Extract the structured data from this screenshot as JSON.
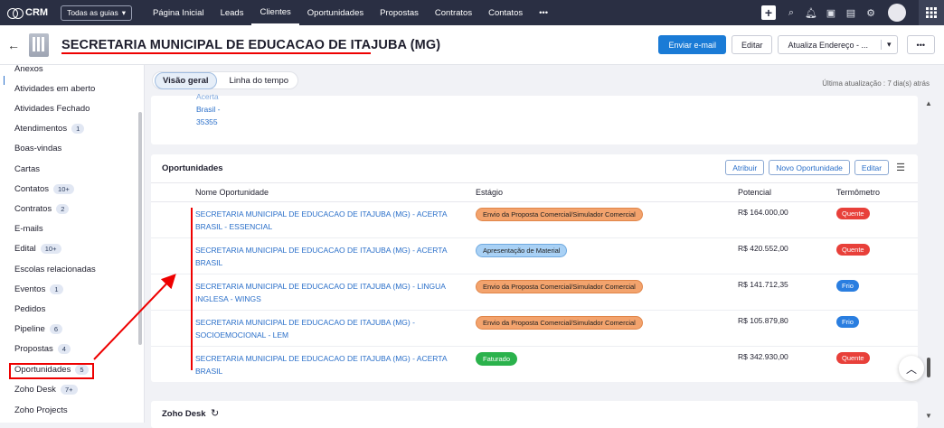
{
  "topbar": {
    "app": "CRM",
    "guides": "Todas as guias",
    "nav": [
      "Página Inicial",
      "Leads",
      "Clientes",
      "Oportunidades",
      "Propostas",
      "Contratos",
      "Contatos",
      "•••"
    ]
  },
  "header": {
    "title": "SECRETARIA MUNICIPAL DE EDUCACAO DE ITAJUBA (MG)",
    "send_email": "Enviar e-mail",
    "edit": "Editar",
    "update": "Atualiza Endereço - ...",
    "more": "•••"
  },
  "sidebar": [
    {
      "label": "Anexos",
      "badge": ""
    },
    {
      "label": "Atividades em aberto",
      "badge": ""
    },
    {
      "label": "Atividades Fechado",
      "badge": ""
    },
    {
      "label": "Atendimentos",
      "badge": "1"
    },
    {
      "label": "Boas-vindas",
      "badge": ""
    },
    {
      "label": "Cartas",
      "badge": ""
    },
    {
      "label": "Contatos",
      "badge": "10+"
    },
    {
      "label": "Contratos",
      "badge": "2"
    },
    {
      "label": "E-mails",
      "badge": ""
    },
    {
      "label": "Edital",
      "badge": "10+"
    },
    {
      "label": "Escolas relacionadas",
      "badge": ""
    },
    {
      "label": "Eventos",
      "badge": "1"
    },
    {
      "label": "Pedidos",
      "badge": ""
    },
    {
      "label": "Pipeline",
      "badge": "6"
    },
    {
      "label": "Propostas",
      "badge": "4"
    },
    {
      "label": "Oportunidades",
      "badge": "5"
    },
    {
      "label": "Zoho Desk",
      "badge": "7+"
    },
    {
      "label": "Zoho Projects",
      "badge": ""
    }
  ],
  "tabs": {
    "overview": "Visão geral",
    "timeline": "Linha do tempo"
  },
  "last_update": "Última atualização : 7 dia(s) atrás",
  "address": [
    "Acerta",
    "Brasil -",
    "35355"
  ],
  "opps": {
    "title": "Oportunidades",
    "assign": "Atribuir",
    "new": "Novo Oportunidade",
    "edit": "Editar",
    "columns": [
      "Nome Oportunidade",
      "Estágio",
      "Potencial",
      "Termômetro"
    ],
    "rows": [
      {
        "name": "SECRETARIA MUNICIPAL DE EDUCACAO DE ITAJUBA (MG) - ACERTA BRASIL - ESSENCIAL",
        "stage": "Envio da Proposta Comercial/Simulador Comercial",
        "value": "R$ 164.000,00",
        "therm": "Quente"
      },
      {
        "name": "SECRETARIA MUNICIPAL DE EDUCACAO DE ITAJUBA (MG) - ACERTA BRASIL",
        "stage": "Apresentação de Material",
        "value": "R$ 420.552,00",
        "therm": "Quente"
      },
      {
        "name": "SECRETARIA MUNICIPAL DE EDUCACAO DE ITAJUBA (MG) - LINGUA INGLESA - WINGS",
        "stage": "Envio da Proposta Comercial/Simulador Comercial",
        "value": "R$ 141.712,35",
        "therm": "Frio"
      },
      {
        "name": "SECRETARIA MUNICIPAL DE EDUCACAO DE ITAJUBA (MG) - SOCIOEMOCIONAL - LEM",
        "stage": "Envio da Proposta Comercial/Simulador Comercial",
        "value": "R$ 105.879,80",
        "therm": "Frio"
      },
      {
        "name": "SECRETARIA MUNICIPAL DE EDUCACAO DE ITAJUBA (MG) - ACERTA BRASIL",
        "stage": "Faturado",
        "value": "R$ 342.930,00",
        "therm": "Quente"
      }
    ]
  },
  "zoho_desk": "Zoho Desk"
}
